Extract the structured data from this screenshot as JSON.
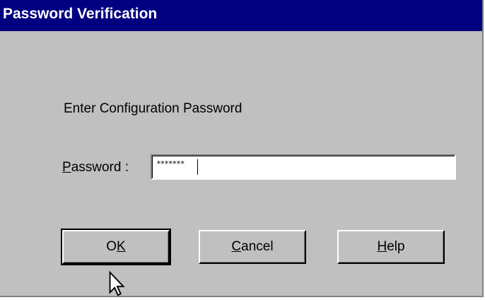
{
  "window": {
    "title": "Password Verification"
  },
  "prompt": "Enter Configuration Password",
  "password_field": {
    "label_mnemonic": "P",
    "label_rest": "assword :",
    "value": "*******"
  },
  "buttons": {
    "ok": {
      "mnemonic_pre": "O",
      "mnemonic": "K",
      "mnemonic_post": ""
    },
    "cancel": {
      "mnemonic_pre": "",
      "mnemonic": "C",
      "mnemonic_post": "ancel"
    },
    "help": {
      "mnemonic_pre": "",
      "mnemonic": "H",
      "mnemonic_post": "elp"
    }
  },
  "colors": {
    "titlebar": "#000080",
    "dialog_face": "#c0c0c0"
  },
  "icons": {
    "pointer": "arrow-cursor-icon"
  }
}
